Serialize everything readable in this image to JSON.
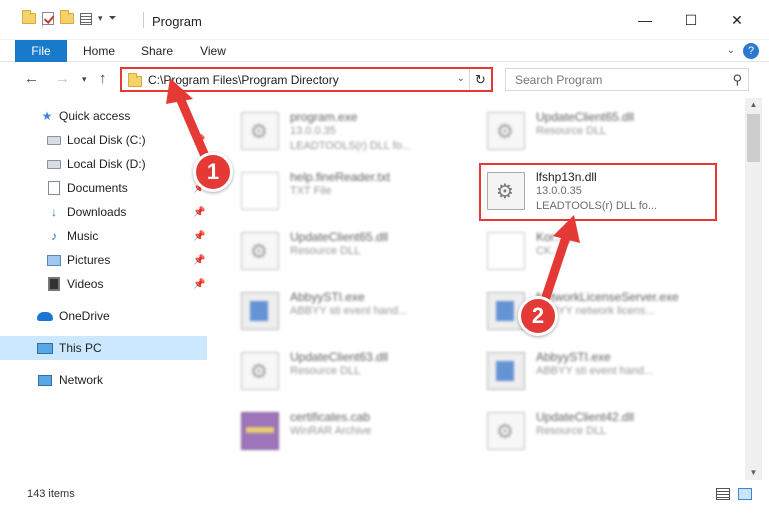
{
  "window": {
    "title": "Program",
    "controls": {
      "minimize": "—",
      "maximize": "☐",
      "close": "✕"
    }
  },
  "ribbon": {
    "tabs": [
      "File",
      "Home",
      "Share",
      "View"
    ],
    "help": "?"
  },
  "nav": {
    "address": "C:\\Program Files\\Program Directory",
    "search_placeholder": "Search Program"
  },
  "sidebar": {
    "items": [
      {
        "label": "Quick access",
        "icon": "star-icon"
      },
      {
        "label": "Local Disk (C:)",
        "icon": "drive-icon"
      },
      {
        "label": "Local Disk (D:)",
        "icon": "drive-icon"
      },
      {
        "label": "Documents",
        "icon": "documents-icon"
      },
      {
        "label": "Downloads",
        "icon": "downloads-icon"
      },
      {
        "label": "Music",
        "icon": "music-icon"
      },
      {
        "label": "Pictures",
        "icon": "pictures-icon"
      },
      {
        "label": "Videos",
        "icon": "videos-icon"
      },
      {
        "label": "OneDrive",
        "icon": "cloud-icon"
      },
      {
        "label": "This PC",
        "icon": "computer-icon",
        "selected": true
      },
      {
        "label": "Network",
        "icon": "network-icon"
      }
    ]
  },
  "files": [
    {
      "name": "program.exe",
      "line1": "13.0.0.35",
      "line2": "LEADTOOLS(r) DLL fo..."
    },
    {
      "name": "UpdateClient65.dll",
      "line1": "Resource DLL",
      "line2": ""
    },
    {
      "name": "help.fineReader.txt",
      "line1": "TXT File",
      "line2": ""
    },
    {
      "name": "lfshp13n.dll",
      "line1": "13.0.0.35",
      "line2": "LEADTOOLS(r) DLL fo..."
    },
    {
      "name": "UpdateClient65.dll",
      "line1": "Resource DLL",
      "line2": ""
    },
    {
      "name": "Kor....jk",
      "line1": "CK...",
      "line2": ""
    },
    {
      "name": "AbbyySTI.exe",
      "line1": "ABBYY sti event hand...",
      "line2": ""
    },
    {
      "name": "NetworkLicenseServer.exe",
      "line1": "ABBYY network licens...",
      "line2": ""
    },
    {
      "name": "UpdateClient63.dll",
      "line1": "Resource DLL",
      "line2": ""
    },
    {
      "name": "AbbyySTI.exe",
      "line1": "ABBYY sti event hand...",
      "line2": ""
    },
    {
      "name": "certificates.cab",
      "line1": "WinRAR Archive",
      "line2": ""
    },
    {
      "name": "UpdateClient42.dll",
      "line1": "Resource DLL",
      "line2": ""
    }
  ],
  "status": {
    "count": "143 items"
  },
  "annotations": {
    "badge1": "1",
    "badge2": "2"
  },
  "colors": {
    "accent": "#1979ca",
    "highlight": "#e53935",
    "selected": "#cce8ff"
  }
}
